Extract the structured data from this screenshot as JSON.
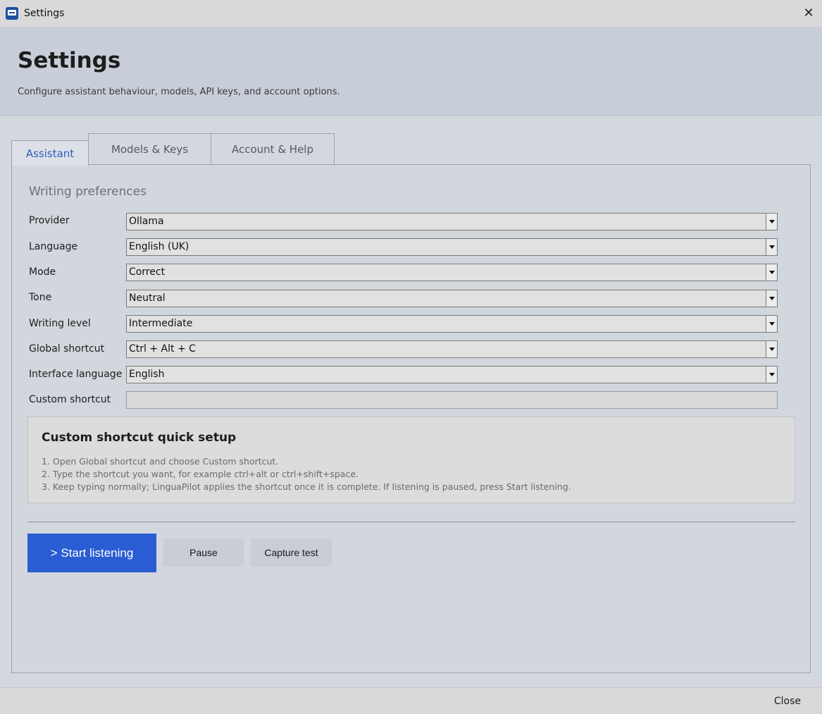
{
  "window": {
    "title": "Settings",
    "close_glyph": "✕"
  },
  "header": {
    "title": "Settings",
    "subtitle": "Configure assistant behaviour, models, API keys, and account options."
  },
  "tabs": [
    {
      "label": "Assistant",
      "active": true
    },
    {
      "label": "Models & Keys",
      "active": false
    },
    {
      "label": "Account & Help",
      "active": false
    }
  ],
  "assistant": {
    "section_title": "Writing preferences",
    "fields": [
      {
        "label": "Provider",
        "value": "Ollama"
      },
      {
        "label": "Language",
        "value": "English (UK)"
      },
      {
        "label": "Mode",
        "value": "Correct"
      },
      {
        "label": "Tone",
        "value": "Neutral"
      },
      {
        "label": "Writing level",
        "value": "Intermediate"
      },
      {
        "label": "Global shortcut",
        "value": "Ctrl + Alt + C"
      },
      {
        "label": "Interface language",
        "value": "English"
      }
    ],
    "custom_shortcut": {
      "label": "Custom shortcut",
      "value": ""
    },
    "quick_setup": {
      "title": "Custom shortcut quick setup",
      "steps": [
        "1. Open Global shortcut and choose Custom shortcut.",
        "2. Type the shortcut you want, for example ctrl+alt or ctrl+shift+space.",
        "3. Keep typing normally; LinguaPilot applies the shortcut once it is complete. If listening is paused, press Start listening."
      ]
    },
    "buttons": {
      "start": "> Start listening",
      "pause": "Pause",
      "capture": "Capture test"
    }
  },
  "footer": {
    "close_label": "Close"
  },
  "colors": {
    "accent": "#2a5cd3",
    "active_tab_text": "#2f5bbf",
    "header_bg": "#c8ced9"
  }
}
